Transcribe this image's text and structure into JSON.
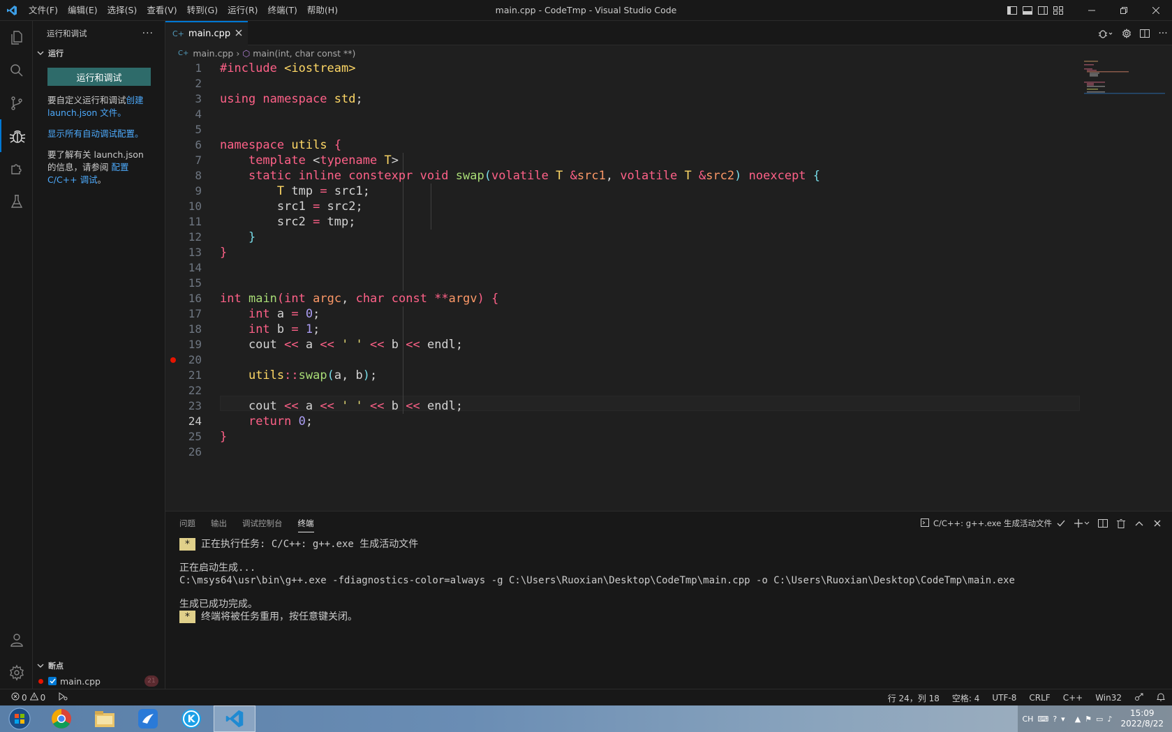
{
  "window": {
    "title": "main.cpp - CodeTmp - Visual Studio Code",
    "menu": [
      "文件(F)",
      "编辑(E)",
      "选择(S)",
      "查看(V)",
      "转到(G)",
      "运行(R)",
      "终端(T)",
      "帮助(H)"
    ]
  },
  "sidebar": {
    "header": "运行和调试",
    "section_run": "运行",
    "run_button": "运行和调试",
    "text1_pre": "要自定义运行和调试",
    "text1_link1": "创建",
    "text1_link2": "launch.json",
    "text1_post": "文件。",
    "link_show_all": "显示所有自动调试配置。",
    "text2_pre": "要了解有关 launch.json 的信息，请参阅",
    "text2_link": "配置 C/C++ 调试",
    "text2_post": "。",
    "breakpoints_header": "断点",
    "breakpoint_file": "main.cpp",
    "breakpoint_line": "21"
  },
  "editor": {
    "tab": "main.cpp",
    "breadcrumb_file": "main.cpp",
    "breadcrumb_symbol": "main(int, char const **)",
    "current_line": 24,
    "breakpoint_line": 21,
    "line_numbers": [
      "1",
      "2",
      "3",
      "4",
      "5",
      "6",
      "7",
      "8",
      "9",
      "10",
      "11",
      "12",
      "13",
      "14",
      "15",
      "16",
      "17",
      "18",
      "19",
      "20",
      "21",
      "22",
      "23",
      "24",
      "25",
      "26"
    ],
    "lines": [
      "#include <iostream>",
      "",
      "using namespace std;",
      "",
      "",
      "namespace utils {",
      "    template <typename T>",
      "    static inline constexpr void swap(volatile T &src1, volatile T &src2) noexcept {",
      "        T tmp = src1;",
      "        src1 = src2;",
      "        src2 = tmp;",
      "    }",
      "}",
      "",
      "",
      "int main(int argc, char const **argv) {",
      "    int a = 0;",
      "    int b = 1;",
      "    cout << a << ' ' << b << endl;",
      "",
      "    utils::swap(a, b);",
      "",
      "    cout << a << ' ' << b << endl;",
      "    return 0;",
      "}",
      ""
    ]
  },
  "panel": {
    "tabs": [
      "问题",
      "输出",
      "调试控制台",
      "终端"
    ],
    "active_tab": "终端",
    "task_label": "C/C++: g++.exe 生成活动文件",
    "terminal": {
      "star": "*",
      "line1": "正在执行任务: C/C++: g++.exe 生成活动文件",
      "line2": "正在启动生成...",
      "line3": "C:\\msys64\\usr\\bin\\g++.exe -fdiagnostics-color=always -g C:\\Users\\Ruoxian\\Desktop\\CodeTmp\\main.cpp -o C:\\Users\\Ruoxian\\Desktop\\CodeTmp\\main.exe",
      "line4": "生成已成功完成。",
      "line5": "终端将被任务重用，按任意键关闭。"
    }
  },
  "statusbar": {
    "errors": "0",
    "warnings": "0",
    "position": "行 24，列 18",
    "spaces": "空格: 4",
    "encoding": "UTF-8",
    "eol": "CRLF",
    "language": "C++",
    "platform": "Win32"
  },
  "taskbar": {
    "lang": "CH",
    "time": "15:09",
    "date": "2022/8/22"
  },
  "colors": {
    "accent": "#0078d4",
    "run_button": "#2e6b6a",
    "breakpoint": "#e51400"
  }
}
